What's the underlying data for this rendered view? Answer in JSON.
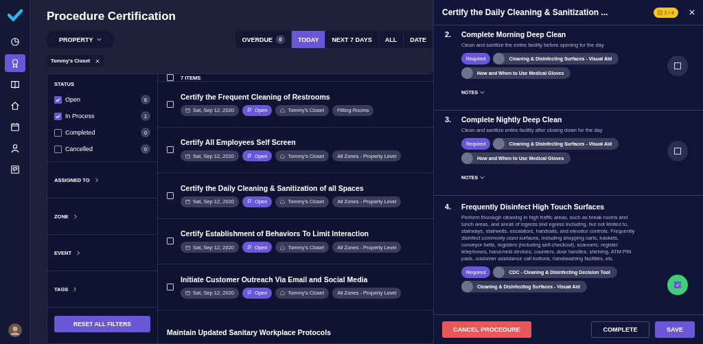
{
  "nav": {
    "items": [
      {
        "kind": "pie",
        "selected": false
      },
      {
        "kind": "award",
        "selected": true
      },
      {
        "kind": "book",
        "selected": false
      },
      {
        "kind": "home",
        "selected": false
      },
      {
        "kind": "calendar",
        "selected": false
      },
      {
        "kind": "person",
        "selected": false
      },
      {
        "kind": "board",
        "selected": false
      }
    ]
  },
  "header": {
    "title": "Procedure Certification",
    "property_button": "PROPERTY"
  },
  "filter_tabs": [
    {
      "label": "OVERDUE",
      "count": "0",
      "selected": false
    },
    {
      "label": "TODAY",
      "selected": true
    },
    {
      "label": "NEXT 7 DAYS",
      "selected": false
    },
    {
      "label": "ALL",
      "selected": false
    },
    {
      "label": "DATE",
      "selected": false
    }
  ],
  "active_filter_chip": "Tommy's Closet",
  "status_filter": {
    "title": "STATUS",
    "options": [
      {
        "label": "Open",
        "count": "6",
        "checked": true
      },
      {
        "label": "In Process",
        "count": "1",
        "checked": true
      },
      {
        "label": "Completed",
        "count": "0",
        "checked": false
      },
      {
        "label": "Cancelled",
        "count": "0",
        "checked": false
      }
    ]
  },
  "filter_sections": [
    "ASSIGNED TO",
    "ZONE",
    "EVENT",
    "TAGS"
  ],
  "reset_button": "RESET ALL FILTERS",
  "tasks": {
    "header": "7 ITEMS",
    "select_all_checked": false,
    "rows": [
      {
        "title": "Certify the Frequent Cleaning of Restrooms",
        "date": "Sat, Sep 12, 2020",
        "status": "Open",
        "property": "Tommy's Closet",
        "zone": "Fitting Rooms",
        "checked": false
      },
      {
        "title": "Certify All Employees Self Screen",
        "date": "Sat, Sep 12, 2020",
        "status": "Open",
        "property": "Tommy's Closet",
        "zone": "All Zones - Property Level",
        "checked": false
      },
      {
        "title": "Certify the Daily Cleaning & Sanitization of all Spaces",
        "date": "Sat, Sep 12, 2020",
        "status": "Open",
        "property": "Tommy's Closet",
        "zone": "All Zones - Property Level",
        "checked": false
      },
      {
        "title": "Certify Establishment of Behaviors To Limit Interaction",
        "date": "Sat, Sep 12, 2020",
        "status": "Open",
        "property": "Tommy's Closet",
        "zone": "All Zones - Property Level",
        "checked": false
      },
      {
        "title": "Initiate Customer Outreach Via Email and Social Media",
        "date": "Sat, Sep 12, 2020",
        "status": "Open",
        "property": "Tommy's Closet",
        "zone": "All Zones - Property Level",
        "checked": false
      },
      {
        "title": "Maintain Updated Sanitary Workplace Protocols"
      }
    ]
  },
  "panel": {
    "title": "Certify the Daily Cleaning & Sanitization ...",
    "progress": "2 / 4",
    "steps": [
      {
        "number": "2.",
        "title": "Complete Morning Deep Clean",
        "description": "Clean and sanitize the entire facility before opening for the day",
        "tags": [
          {
            "kind": "required",
            "label": "Required"
          },
          {
            "kind": "resource",
            "label": "Cleaning & Disinfecting Surfaces - Visual Aid"
          },
          {
            "kind": "resource",
            "label": "How and When to Use Medical Gloves"
          }
        ],
        "notes": "NOTES",
        "checked": false
      },
      {
        "number": "3.",
        "title": "Complete Nightly Deep Clean",
        "description": "Clean and sanitize entire facility after closing down for the day",
        "tags": [
          {
            "kind": "required",
            "label": "Required"
          },
          {
            "kind": "resource",
            "label": "Cleaning & Disinfecting Surfaces - Visual Aid"
          },
          {
            "kind": "resource",
            "label": "How and When to Use Medical Gloves"
          }
        ],
        "notes": "NOTES",
        "checked": false
      },
      {
        "number": "4.",
        "title": "Frequently Disinfect High Touch Surfaces",
        "description": "Perform thorough cleaning in high traffic areas, such as break rooms and lunch areas, and areas of ingress and egress including, but not limited to, stairways, stairwells, escalators, handrails, and elevator controls. Frequently disinfect commonly used surfaces, including shopping carts, baskets, conveyor belts, registers (including self-checkout), scanners, register telephones, hand-held devices, counters, door handles, shelving, ATM PIN pads, customer assistance call buttons, handwashing facilities, etc.",
        "tags": [
          {
            "kind": "required",
            "label": "Required"
          },
          {
            "kind": "resource",
            "label": "CDC - Cleaning & Disinfecting Decision Tool"
          },
          {
            "kind": "resource",
            "label": "Cleaning & Disinfecting Surfaces - Visual Aid"
          }
        ],
        "checked": true
      }
    ],
    "buttons": {
      "cancel": "CANCEL PROCEDURE",
      "complete": "COMPLETE",
      "save": "SAVE"
    }
  }
}
